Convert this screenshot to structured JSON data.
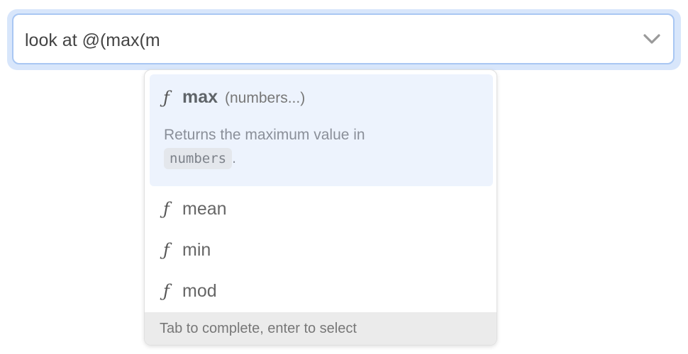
{
  "input": {
    "value": "look at @(max(m"
  },
  "dropdown": {
    "selected": {
      "icon": "function-icon",
      "name": "max",
      "signature": "(numbers...)",
      "description_prefix": "Returns the maximum value in",
      "description_code": "numbers",
      "description_suffix": "."
    },
    "items": [
      {
        "icon": "function-icon",
        "label": "mean"
      },
      {
        "icon": "function-icon",
        "label": "min"
      },
      {
        "icon": "function-icon",
        "label": "mod"
      }
    ],
    "footer": "Tab to complete, enter to select"
  },
  "colors": {
    "focus_ring": "#d8e6fb",
    "input_border": "#a9c7f3",
    "selected_bg": "#edf3fd",
    "footer_bg": "#ebebeb"
  }
}
